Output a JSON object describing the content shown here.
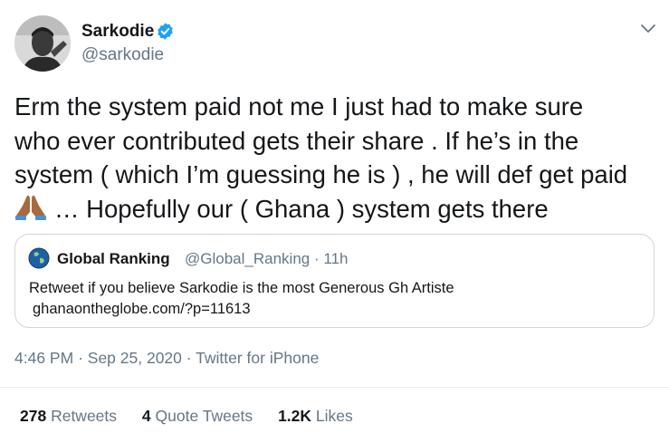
{
  "author": {
    "display_name": "Sarkodie",
    "handle": "@sarkodie",
    "verified": true
  },
  "tweet": {
    "lines": [
      "Erm the system paid not me I just had to make sure",
      "who ever contributed gets their share . If he’s in the",
      "system ( which I’m guessing he is ) , he will def get paid",
      "… Hopefully our ( Ghana ) system gets there"
    ],
    "emoji": "folded-hands-emoji"
  },
  "quoted_tweet": {
    "display_name": "Global Ranking",
    "handle": "@Global_Ranking",
    "separator": "·",
    "age": "11h",
    "text": "Retweet if you believe Sarkodie is the most Generous Gh Artiste",
    "link": "ghanaontheglobe.com/?p=11613"
  },
  "meta": {
    "time": "4:46 PM",
    "separator": "·",
    "date": "Sep 25, 2020",
    "source": "Twitter for iPhone"
  },
  "stats": {
    "retweets_count": "278",
    "retweets_label": "Retweets",
    "quotes_count": "4",
    "quotes_label": "Quote Tweets",
    "likes_count": "1.2K",
    "likes_label": "Likes"
  },
  "colors": {
    "verified": "#1da1f2",
    "secondary_text": "#657786",
    "border": "#ccd6dd"
  }
}
